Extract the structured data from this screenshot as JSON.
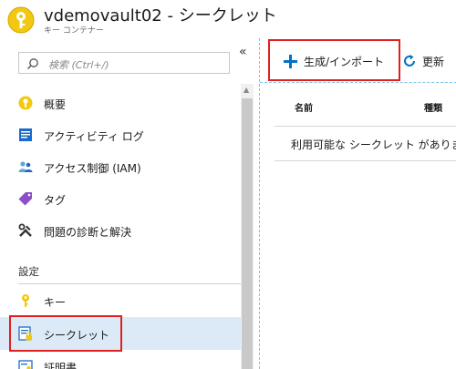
{
  "header": {
    "title": "vdemovault02 - シークレット",
    "subtitle": "キー コンテナー"
  },
  "search": {
    "placeholder": "検索 (Ctrl+/)"
  },
  "collapse_glyph": "«",
  "menu": [
    {
      "label": "概要",
      "icon": "key-vault-icon"
    },
    {
      "label": "アクティビティ ログ",
      "icon": "activity-log-icon"
    },
    {
      "label": "アクセス制御 (IAM)",
      "icon": "users-icon"
    },
    {
      "label": "タグ",
      "icon": "tag-icon"
    },
    {
      "label": "問題の診断と解決",
      "icon": "tools-icon"
    }
  ],
  "settings": {
    "heading": "設定",
    "items": [
      {
        "label": "キー",
        "icon": "key-icon"
      },
      {
        "label": "シークレット",
        "icon": "secret-icon",
        "selected": true
      },
      {
        "label": "証明書",
        "icon": "certificate-icon"
      }
    ]
  },
  "commands": {
    "generate_import": "生成/インポート",
    "refresh": "更新"
  },
  "table": {
    "columns": [
      "名前",
      "種類"
    ],
    "empty_message": "利用可能な シークレット がありま"
  },
  "colors": {
    "accent": "#0072c6",
    "highlight": "#e02020",
    "selected_bg": "#dceaf7",
    "key_yellow": "#f2c811"
  }
}
